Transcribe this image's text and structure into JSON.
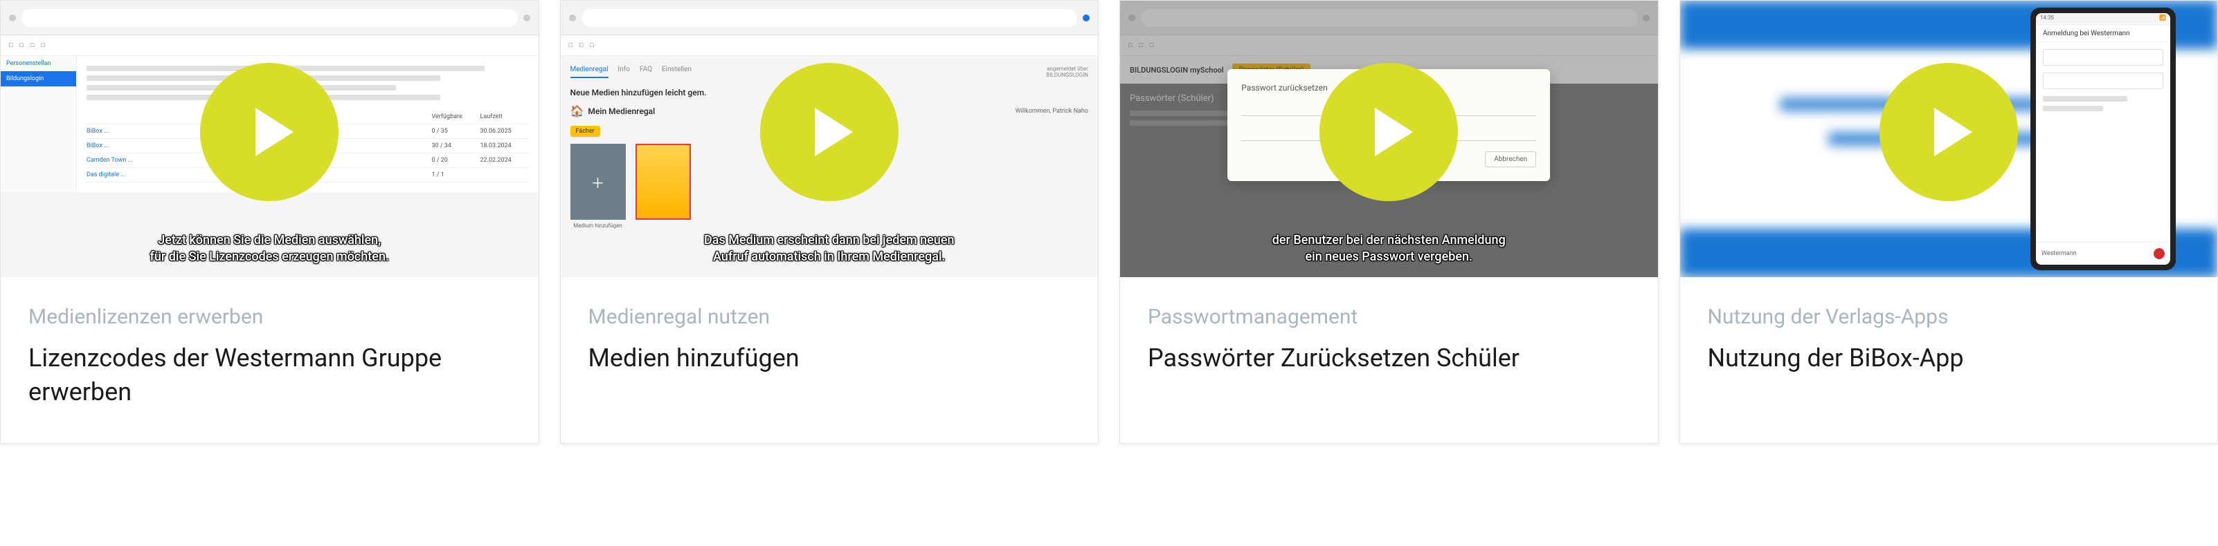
{
  "cards": [
    {
      "category": "Medienlizenzen erwerben",
      "title": "Lizenzcodes der Westermann Gruppe erwerben",
      "caption": "Jetzt können Sie die Medien auswählen,\nfür die Sie Lizenzcodes erzeugen möchten.",
      "thumbnail": {
        "sidebar_items": [
          "Personenstellan",
          "Bildungslogin"
        ],
        "table_header_c2": "Verfügbare",
        "table_header_c3": "Laufzeit",
        "rows": [
          {
            "c1": "BiBox ...",
            "c2": "0 / 35",
            "c3": "30.06.2025"
          },
          {
            "c1": "BiBox ...",
            "c2": "30 / 34",
            "c3": "18.03.2024"
          },
          {
            "c1": "Camden Town ...",
            "c2": "0 / 20",
            "c3": "22.02.2024"
          },
          {
            "c1": "Das digitale ...",
            "c2": "1 / 1",
            "c3": ""
          }
        ]
      }
    },
    {
      "category": "Medienregal nutzen",
      "title": "Medien hinzufügen",
      "caption": "Das Medium erscheint dann bei jedem neuen\nAufruf automatisch in Ihrem Medienregal.",
      "thumbnail": {
        "tabs": [
          "Medienregal",
          "Info",
          "FAQ",
          "Einstellen"
        ],
        "section_title": "Neue Medien hinzufügen leicht gem.",
        "shelf_title": "Mein Medienregal",
        "welcome": "Willkommen, Patrick Naho",
        "add_label": "Medium hinzufügen",
        "filter_btn": "Fächer",
        "powered": "angemeldet über",
        "powered_name": "BILDUNGSLOGIN"
      }
    },
    {
      "category": "Passwortmanagement",
      "title": "Passwörter Zurücksetzen Schüler",
      "caption": "der Benutzer bei der nächsten Anmeldung\nein neues Passwort vergeben.",
      "thumbnail": {
        "app_title": "BILDUNGSLOGIN mySchool",
        "tab_label": "Passwörter (Schüler)",
        "section_title": "Passwörter (Schüler)",
        "modal_title": "Passwort zurücksetzen",
        "modal_cancel": "Abbrechen"
      }
    },
    {
      "category": "Nutzung der Verlags-Apps",
      "title": "Nutzung der BiBox-App",
      "caption": "",
      "thumbnail": {
        "phone_title": "Anmeldung bei Westermann",
        "phone_footer": "Westermann",
        "phone_time": "14:35"
      }
    }
  ],
  "play_icon_name": "play-icon"
}
